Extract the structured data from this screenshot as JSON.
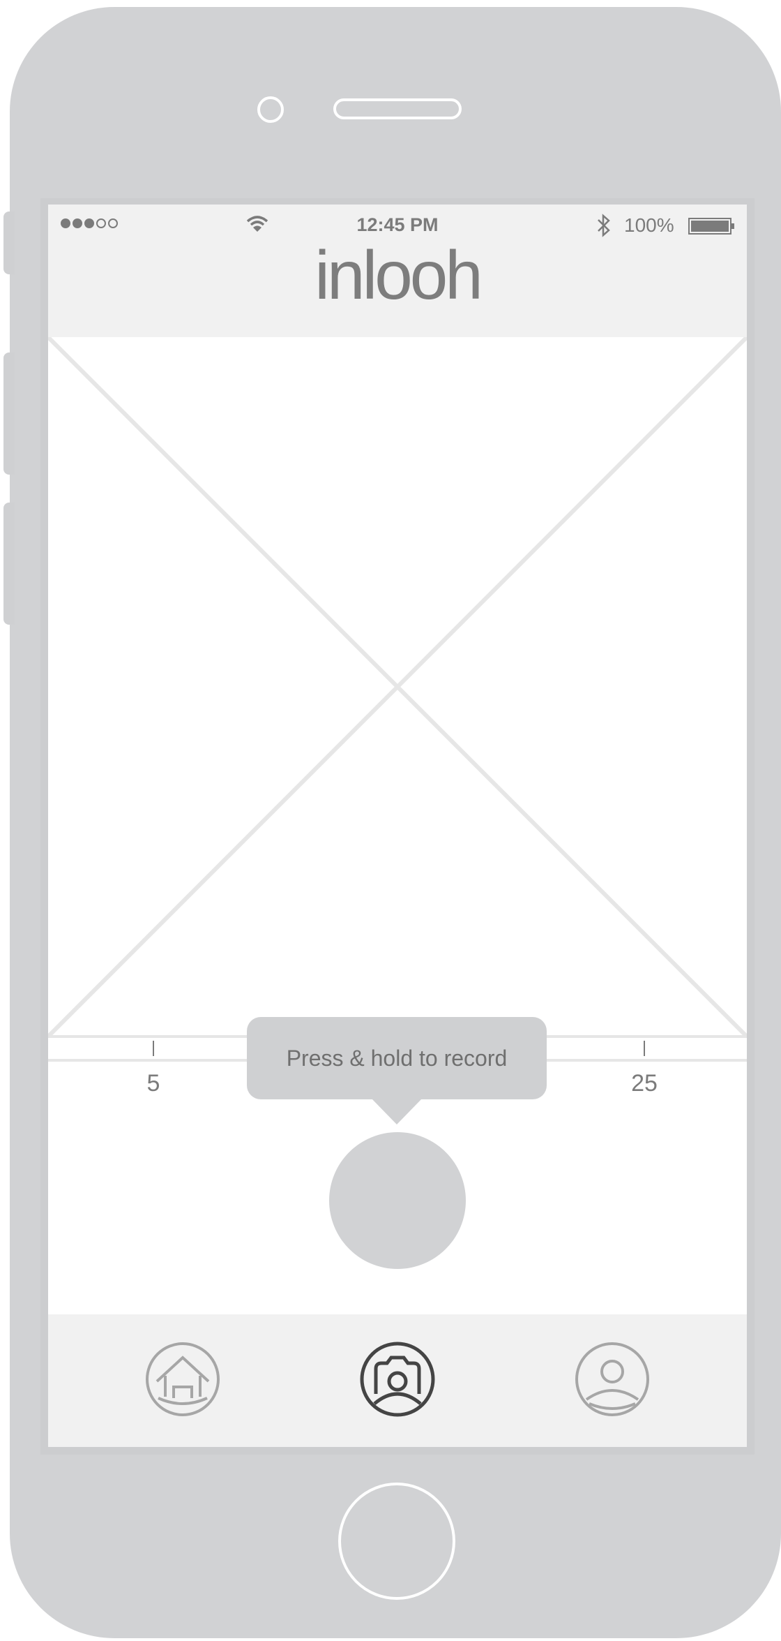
{
  "status_bar": {
    "time": "12:45 PM",
    "battery_percent": "100%",
    "signal_bars_filled": 3,
    "signal_bars_total": 5,
    "wifi_icon": "wifi-icon",
    "bluetooth_icon": "bluetooth-icon",
    "battery_icon": "battery-icon"
  },
  "header": {
    "logo_text": "inlooh"
  },
  "media": {
    "placeholder_icon": "image-placeholder-x"
  },
  "slider": {
    "tick_labels": [
      "5",
      "25"
    ]
  },
  "tooltip": {
    "text": "Press & hold to record"
  },
  "record_button": {
    "icon": "record-circle"
  },
  "tab_bar": {
    "tabs": [
      {
        "icon": "home-icon",
        "active": false
      },
      {
        "icon": "camera-icon",
        "active": true
      },
      {
        "icon": "profile-icon",
        "active": false
      }
    ]
  },
  "colors": {
    "device": "#d1d2d4",
    "header_bg": "#f1f1f1",
    "text_gray": "#7b7b7b",
    "active_icon": "#444444",
    "inactive_icon": "#a6a6a6",
    "placeholder_line": "#e6e6e6"
  }
}
